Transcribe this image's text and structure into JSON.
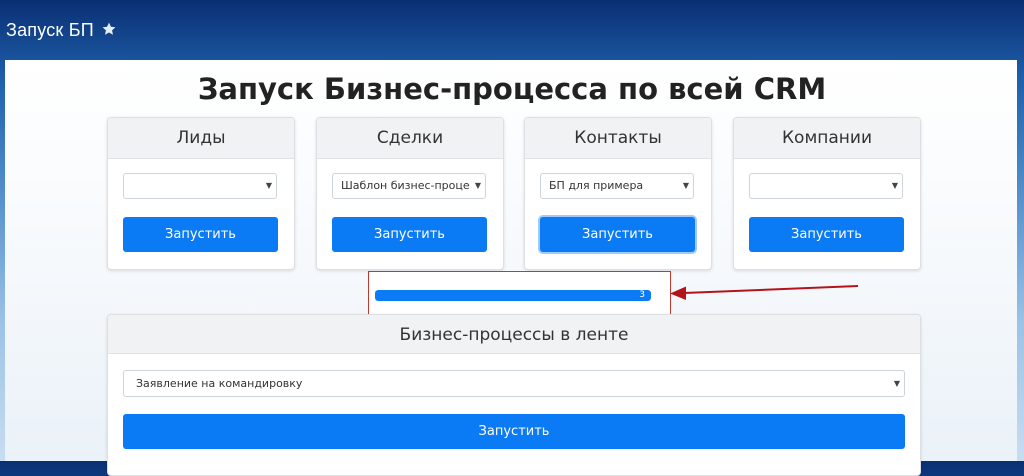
{
  "header": {
    "title": "Запуск БП",
    "star_icon": "star-icon"
  },
  "main": {
    "heading": "Запуск Бизнес-процесса по всей CRM",
    "cards": [
      {
        "title": "Лиды",
        "select_value": "",
        "button_label": "Запустить"
      },
      {
        "title": "Сделки",
        "select_value": "Шаблон бизнес-проце",
        "button_label": "Запустить"
      },
      {
        "title": "Контакты",
        "select_value": "БП для примера",
        "button_label": "Запустить"
      },
      {
        "title": "Компании",
        "select_value": "",
        "button_label": "Запустить"
      }
    ],
    "progress": {
      "label": "3",
      "fill_fraction": 1.0
    },
    "feed": {
      "title": "Бизнес-процессы в ленте",
      "select_value": "Заявление на командировку",
      "button_label": "Запустить"
    }
  },
  "icons": {
    "dropdown": "chevron-down-icon",
    "annotation": "arrow-icon"
  },
  "colors": {
    "primary": "#0b7bf5",
    "annotation": "#c0392b"
  }
}
